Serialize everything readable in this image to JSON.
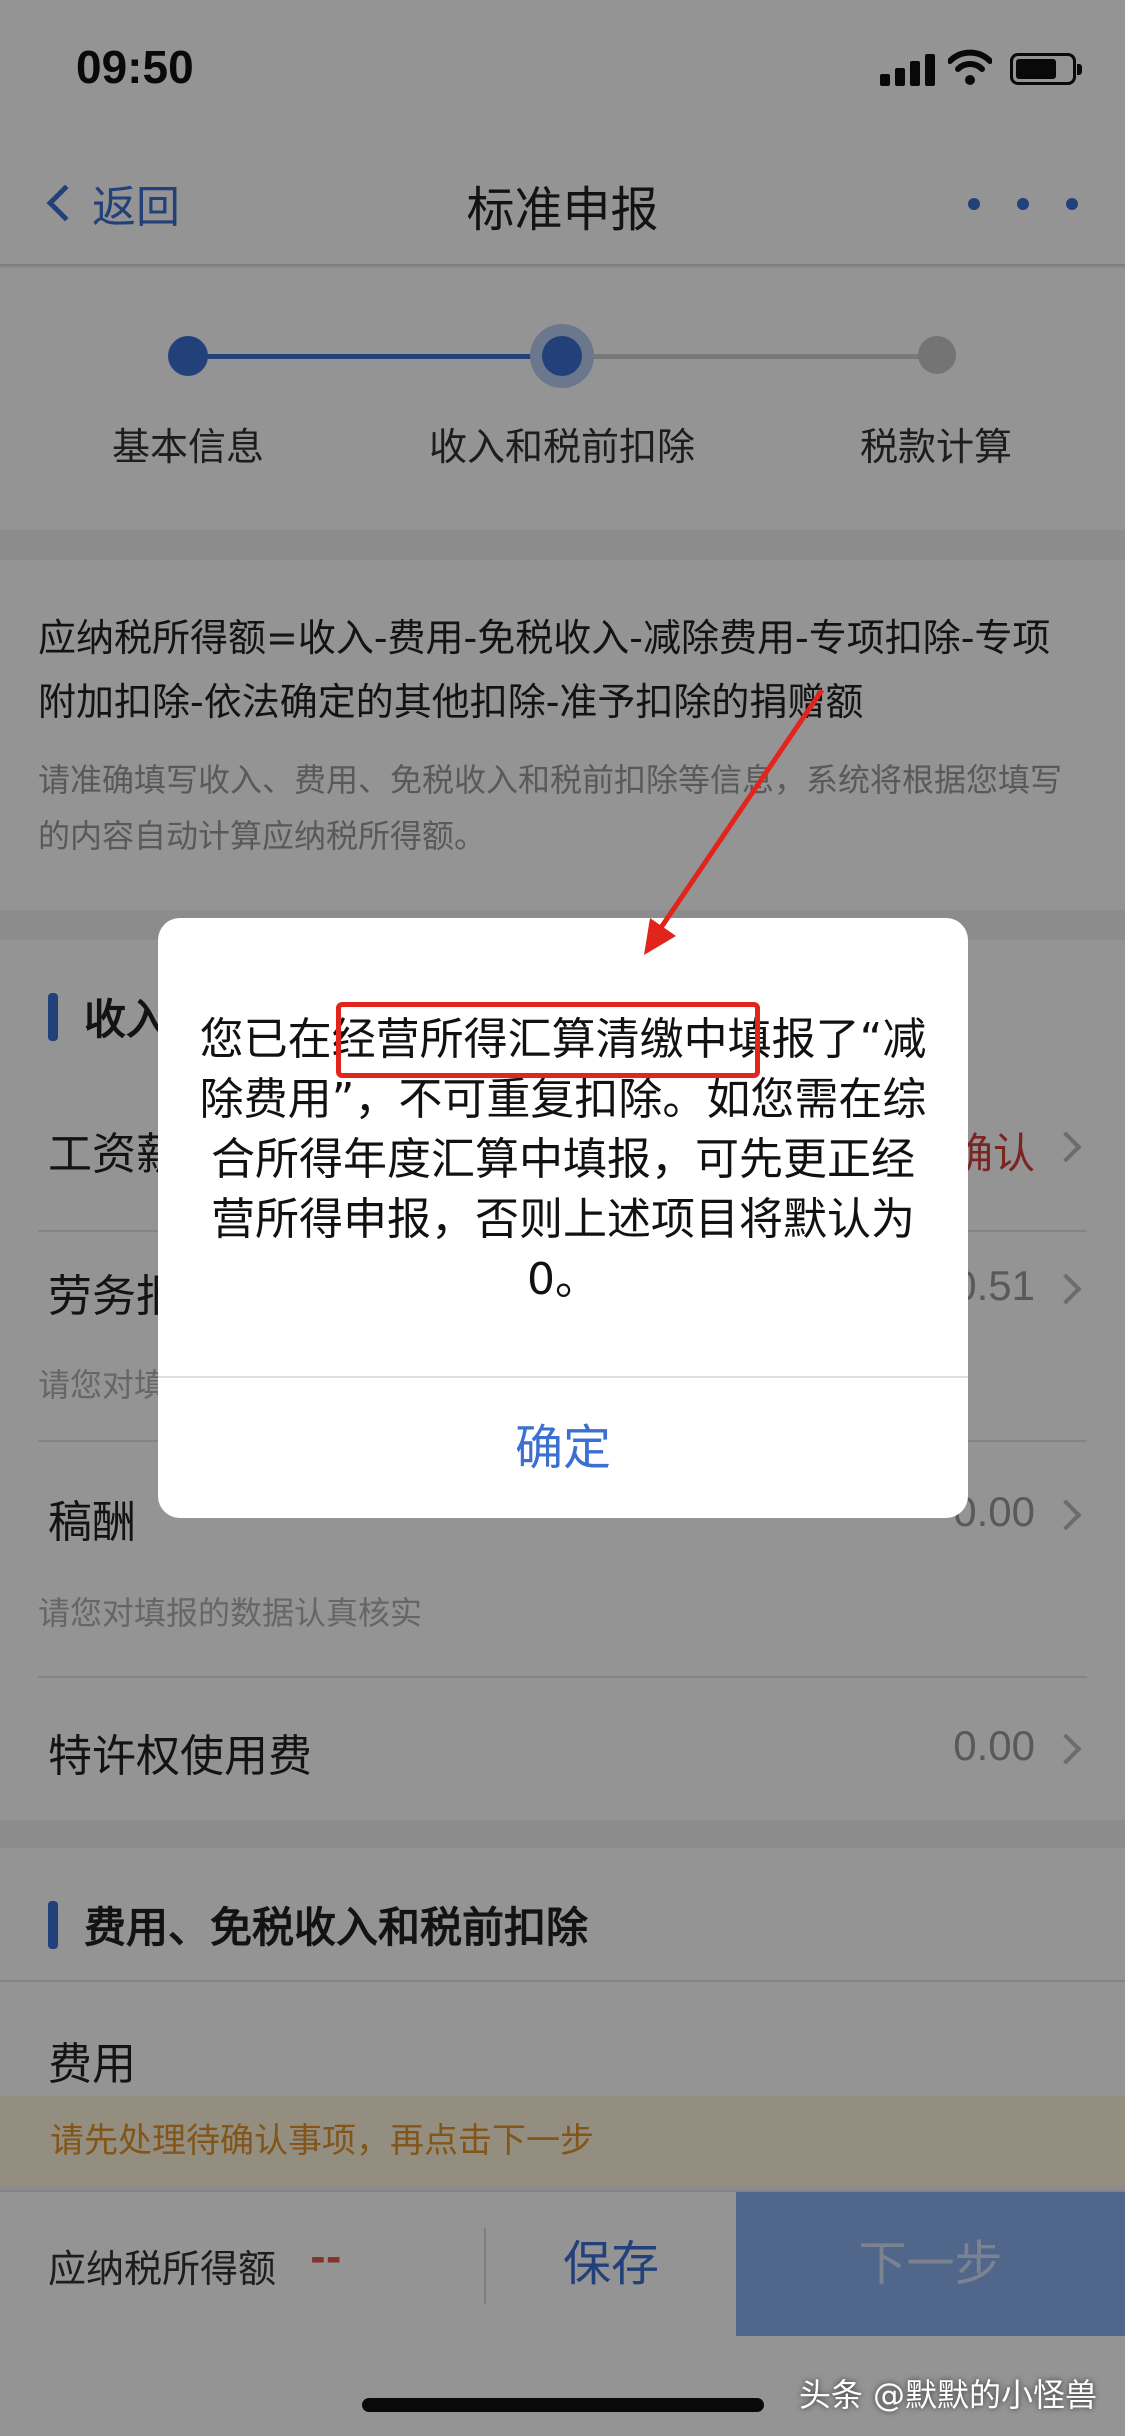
{
  "status_bar": {
    "time": "09:50"
  },
  "nav": {
    "back_label": "返回",
    "title": "标准申报"
  },
  "steps": [
    "基本信息",
    "收入和税前扣除",
    "税款计算"
  ],
  "formula": {
    "text": "应纳税所得额=收入-费用-免税收入-减除费用-专项扣除-专项附加扣除-依法确定的其他扣除-准予扣除的捐赠额",
    "hint": "请准确填写收入、费用、免税收入和税前扣除等信息，系统将根据您填写的内容自动计算应纳税所得额。"
  },
  "income_section": {
    "title": "收入",
    "rows": [
      {
        "label": "工资薪金",
        "value": "待确认",
        "value_color": "#d3413a"
      },
      {
        "label": "劳务报酬",
        "value": "0.51",
        "note": "请您对填报的数据认真核实"
      },
      {
        "label": "稿酬",
        "value": "0.00",
        "note": "请您对填报的数据认真核实"
      },
      {
        "label": "特许权使用费",
        "value": "0.00"
      }
    ]
  },
  "deduct_section": {
    "title": "费用、免税收入和税前扣除",
    "rows": [
      {
        "label": "费用"
      }
    ]
  },
  "warning_banner": "请先处理待确认事项，再点击下一步",
  "bottom_bar": {
    "tax_label": "应纳税所得额",
    "tax_value": "--",
    "save_label": "保存",
    "next_label": "下一步"
  },
  "dialog": {
    "message_before": "您已在",
    "message_highlight": "经营所得汇算清缴中",
    "message_after": "填报了“减除费用”，不可重复扣除。如您需在综合所得年度汇算中填报，可先更正经营所得申报，否则上述项目将默认为0。",
    "confirm_label": "确定"
  },
  "watermark": "头条 @默默的小怪兽",
  "colors": {
    "accent": "#3b6fd1",
    "warning_text": "#e0932b",
    "annotation_red": "#e1241c"
  }
}
